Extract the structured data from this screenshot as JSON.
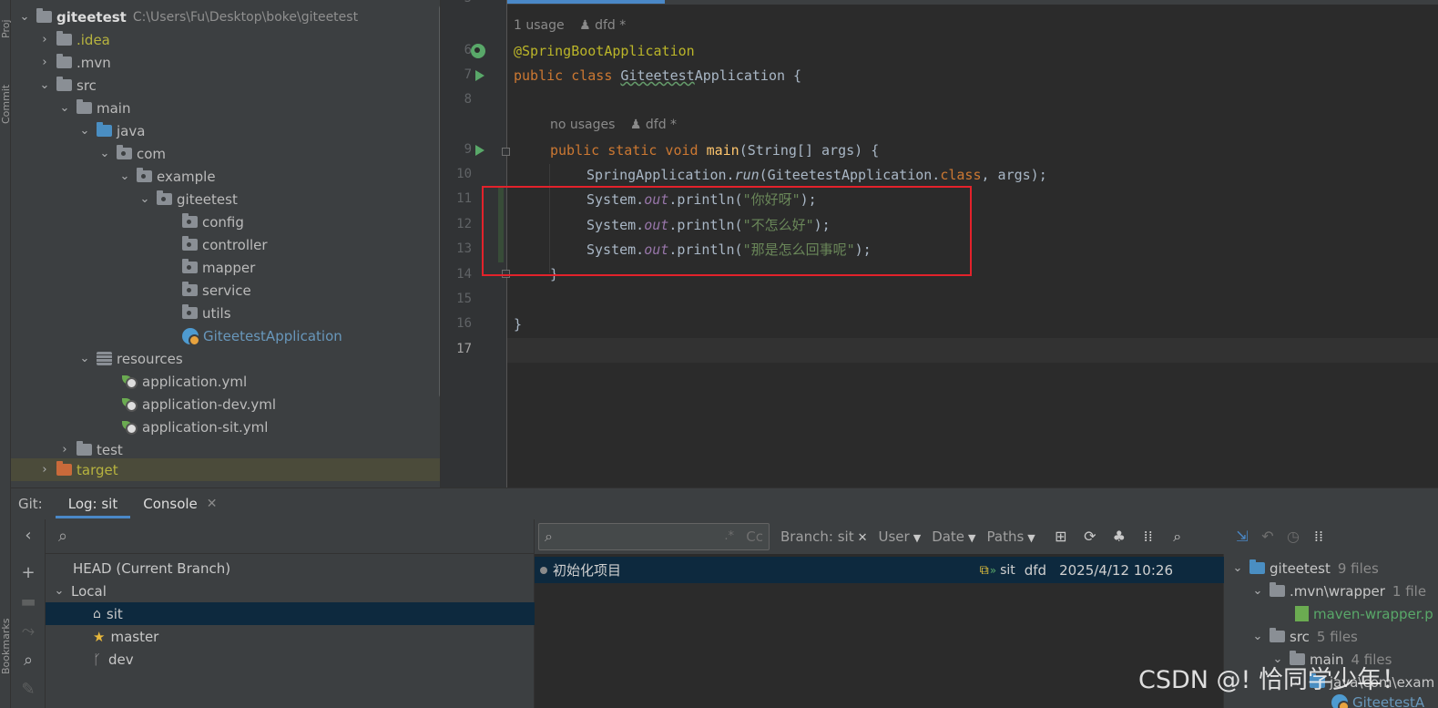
{
  "side_tabs": {
    "project": "Proj",
    "commit": "Commit",
    "bookmarks": "Bookmarks"
  },
  "project_tree": {
    "root": {
      "name": "giteetest",
      "path": "C:\\Users\\Fu\\Desktop\\boke\\giteetest"
    },
    "items": [
      {
        "label": ".idea"
      },
      {
        "label": ".mvn"
      },
      {
        "label": "src"
      },
      {
        "label": "main"
      },
      {
        "label": "java"
      },
      {
        "label": "com"
      },
      {
        "label": "example"
      },
      {
        "label": "giteetest"
      },
      {
        "label": "config"
      },
      {
        "label": "controller"
      },
      {
        "label": "mapper"
      },
      {
        "label": "service"
      },
      {
        "label": "utils"
      },
      {
        "label": "GiteetestApplication"
      },
      {
        "label": "resources"
      },
      {
        "label": "application.yml"
      },
      {
        "label": "application-dev.yml"
      },
      {
        "label": "application-sit.yml"
      },
      {
        "label": "test"
      },
      {
        "label": "target"
      }
    ]
  },
  "editor": {
    "partial_top_line": "5",
    "hints": [
      {
        "usage": "1 usage",
        "author": "dfd *"
      },
      {
        "usage": "no usages",
        "author": "dfd *"
      }
    ],
    "line_numbers": [
      "6",
      "7",
      "8",
      "9",
      "10",
      "11",
      "12",
      "13",
      "14",
      "15",
      "16",
      "17"
    ],
    "code": {
      "l6": "@SpringBootApplication",
      "l7_kw": "public class ",
      "l7_class_typo": "Giteetest",
      "l7_class_rest": "Application",
      "l7_brace": " {",
      "l9_kw": "public static void ",
      "l9_fn": "main",
      "l9_rest": "(String[] args) {",
      "l10_a": "SpringApplication.",
      "l10_run": "run",
      "l10_b": "(GiteetestApplication.",
      "l10_class": "class",
      "l10_c": ", args);",
      "sys": "System.",
      "out": "out",
      "println": ".println(",
      "l11_str": "\"你好呀\"",
      "l12_str": "\"不怎么好\"",
      "l13_str": "\"那是怎么回事呢\"",
      "close": ");",
      "l14": "}",
      "l16": "}"
    }
  },
  "tool_window": {
    "label": "Git:",
    "tabs": [
      {
        "label": "Log: sit"
      },
      {
        "label": "Console"
      }
    ]
  },
  "branches": {
    "head": "HEAD (Current Branch)",
    "local_group": "Local",
    "items": [
      {
        "name": "sit"
      },
      {
        "name": "master"
      },
      {
        "name": "dev"
      }
    ]
  },
  "log": {
    "filters": {
      "branch": "Branch: sit",
      "user": "User",
      "date": "Date",
      "paths": "Paths"
    },
    "search_hint_regex": ".*",
    "search_hint_case": "Cc",
    "commits": [
      {
        "message": "初始化项目",
        "refs": "sit",
        "author": "dfd",
        "date": "2025/4/12 10:26"
      }
    ]
  },
  "changes": {
    "rows": [
      {
        "name": "giteetest",
        "count": "9 files"
      },
      {
        "name": ".mvn\\wrapper",
        "count": "1 file"
      },
      {
        "name": "maven-wrapper.p",
        "count": ""
      },
      {
        "name": "src",
        "count": "5 files"
      },
      {
        "name": "main",
        "count": "4 files"
      },
      {
        "name": "java\\com\\exam",
        "count": ""
      },
      {
        "name": "GiteetestA",
        "count": ""
      }
    ]
  },
  "watermark": "CSDN @! 恰同学少年！",
  "colors": {
    "highlight_box": "#e3222b",
    "selection": "#0d293e",
    "accent": "#4a88c7"
  }
}
